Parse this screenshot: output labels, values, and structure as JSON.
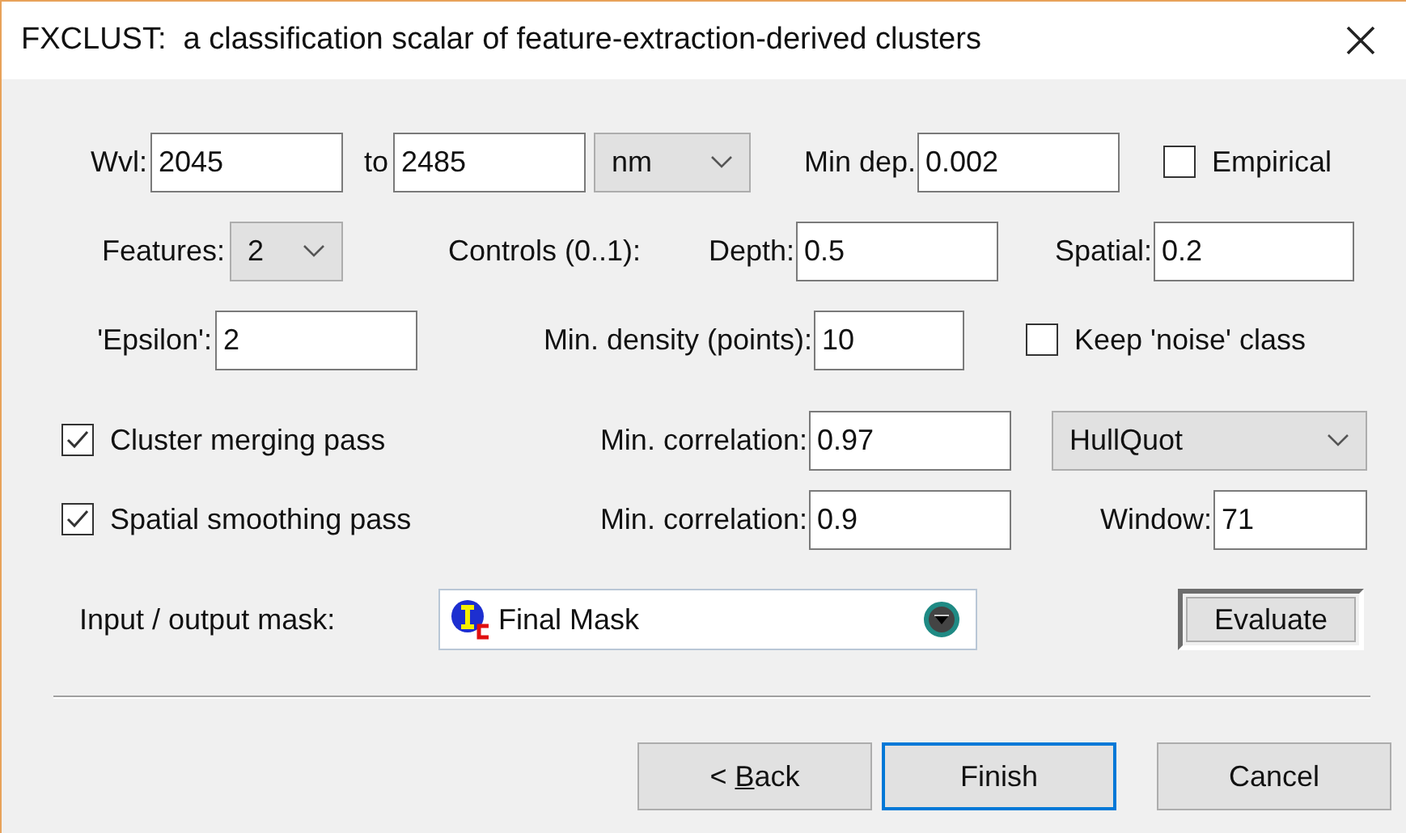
{
  "window": {
    "title": "FXCLUST:  a classification scalar of feature-extraction-derived clusters"
  },
  "wavelength": {
    "label": "Wvl:",
    "from": "2045",
    "to_label": "to",
    "to": "2485",
    "unit": "nm"
  },
  "min_depth": {
    "label": "Min dep.",
    "value": "0.002"
  },
  "empirical": {
    "label": "Empirical",
    "checked": false
  },
  "features": {
    "label": "Features:",
    "value": "2"
  },
  "controls_label": "Controls (0..1):",
  "depth": {
    "label": "Depth:",
    "value": "0.5"
  },
  "spatial": {
    "label": "Spatial:",
    "value": "0.2"
  },
  "epsilon": {
    "label": "'Epsilon':",
    "value": "2"
  },
  "min_density": {
    "label": "Min. density (points):",
    "value": "10"
  },
  "keep_noise": {
    "label": "Keep 'noise' class",
    "checked": false
  },
  "merging": {
    "label": "Cluster merging pass",
    "checked": true,
    "correlation_label": "Min. correlation:",
    "correlation": "0.97"
  },
  "method": {
    "value": "HullQuot"
  },
  "smoothing": {
    "label": "Spatial smoothing pass",
    "checked": true,
    "correlation_label": "Min. correlation:",
    "correlation": "0.9"
  },
  "window_size": {
    "label": "Window:",
    "value": "71"
  },
  "mask": {
    "label": "Input / output mask:",
    "value": "Final Mask"
  },
  "evaluate": {
    "label": "Evaluate"
  },
  "buttons": [
    {
      "label": [
        {
          "text": "< ",
          "underlined": false
        },
        {
          "text": "B",
          "underlined": true
        },
        {
          "text": "ack",
          "underlined": false
        }
      ],
      "default": false
    },
    {
      "label": [
        {
          "text": "Finish",
          "underlined": false
        }
      ],
      "default": true
    },
    {
      "label": [
        {
          "text": "Cancel",
          "underlined": false
        }
      ],
      "default": false
    }
  ]
}
